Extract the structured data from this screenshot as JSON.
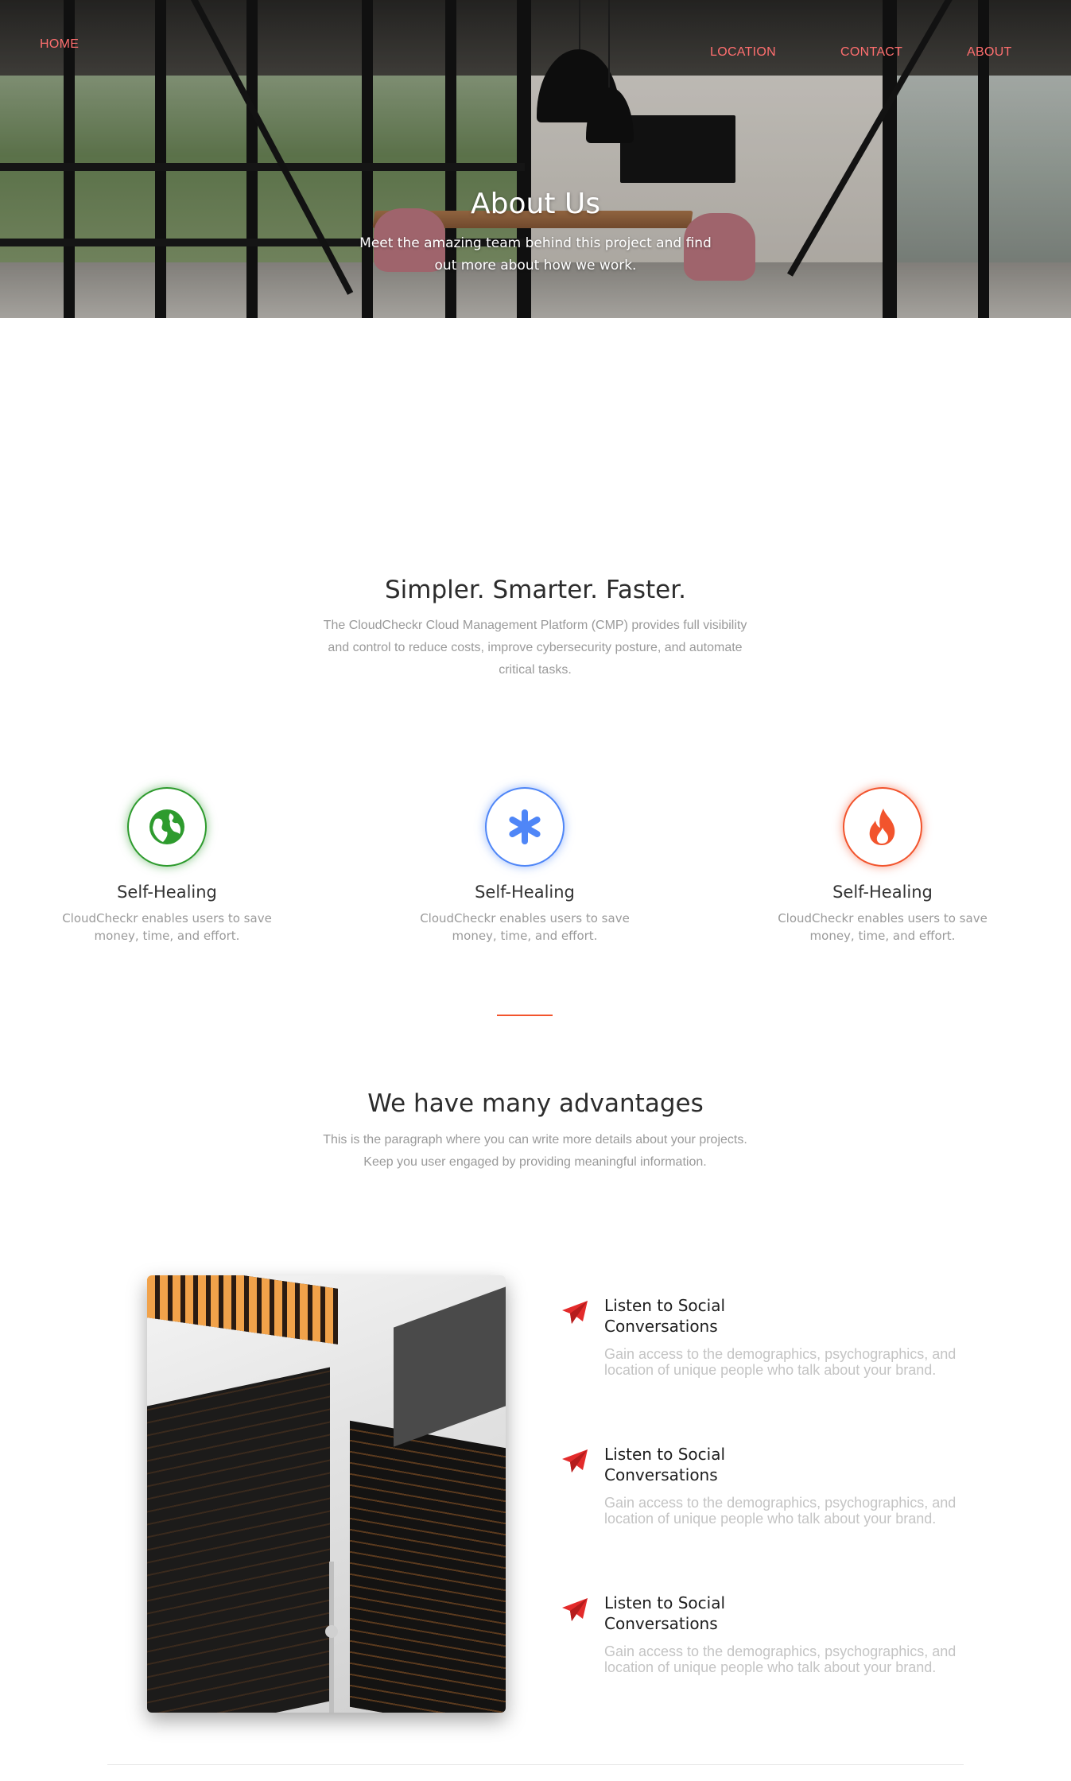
{
  "nav": {
    "home": "HOME",
    "location": "LOCATION",
    "contact": "CONTACT",
    "about": "ABOUT",
    "link_color": "#ff6f6f"
  },
  "hero": {
    "title": "About Us",
    "subtitle": "Meet the amazing team behind this project and find out more about how we work."
  },
  "intro": {
    "title": "Simpler. Smarter. Faster.",
    "text": "The CloudCheckr Cloud Management Platform (CMP) provides full visibility and control to reduce costs, improve cybersecurity posture, and automate critical tasks."
  },
  "features": [
    {
      "icon": "globe-icon",
      "color": "#2e9b2e",
      "title": "Self-Healing",
      "text": "CloudCheckr enables users to save money, time, and effort."
    },
    {
      "icon": "asterisk-icon",
      "color": "#4f86f7",
      "title": "Self-Healing",
      "text": "CloudCheckr enables users to save money, time, and effort."
    },
    {
      "icon": "fire-icon",
      "color": "#f2542d",
      "title": "Self-Healing",
      "text": "CloudCheckr enables users to save money, time, and effort."
    }
  ],
  "advantages": {
    "title": "We have many advantages",
    "text": "This is the paragraph where you can write more details about your projects. Keep you user engaged by providing meaningful information.",
    "items": [
      {
        "icon": "paper-plane-icon",
        "title": "Listen to Social Conversations",
        "text": "Gain access to the demographics, psychographics, and location of unique people who talk about your brand."
      },
      {
        "icon": "paper-plane-icon",
        "title": "Listen to Social Conversations",
        "text": "Gain access to the demographics, psychographics, and location of unique people who talk about your brand."
      },
      {
        "icon": "paper-plane-icon",
        "title": "Listen to Social Conversations",
        "text": "Gain access to the demographics, psychographics, and location of unique people who talk about your brand."
      }
    ],
    "accent": "#e32b2b"
  }
}
